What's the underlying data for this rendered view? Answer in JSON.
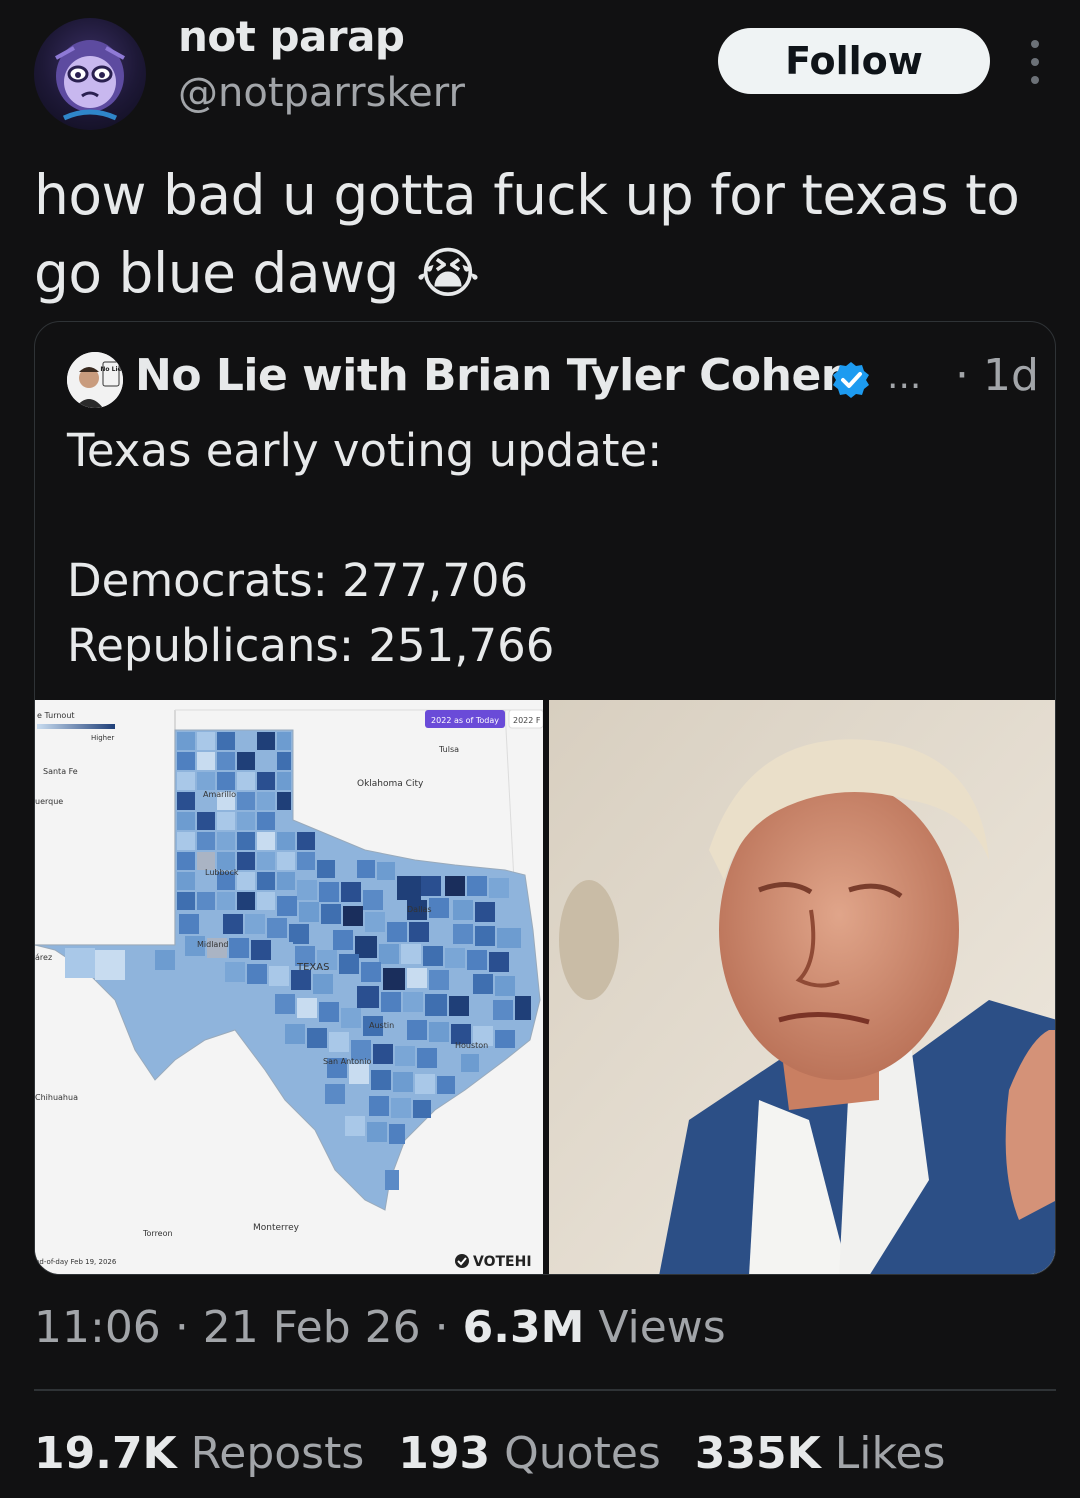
{
  "tweet": {
    "author": {
      "display_name": "not parap",
      "handle": "@notparrskerr"
    },
    "follow_label": "Follow",
    "text": "how bad u gotta fuck up for texas to go blue dawg",
    "emoji": "😭",
    "timestamp": "11:06",
    "date": "21 Feb 26",
    "views_count": "6.3M",
    "views_label": "Views",
    "stats": {
      "reposts_count": "19.7K",
      "reposts_label": "Reposts",
      "quotes_count": "193",
      "quotes_label": "Quotes",
      "likes_count": "335K",
      "likes_label": "Likes"
    }
  },
  "quote": {
    "author_name": "No Lie with Brian Tyler Cohen",
    "avatar_text": "No Lie",
    "ellipsis": "...",
    "time": "· 1d",
    "text": "Texas early voting update:\n\nDemocrats: 277,706\nRepublicans: 251,766",
    "map": {
      "legend_title": "e Turnout",
      "legend_sub": "Higher",
      "tab_active": "2022 as of Today",
      "tab_other": "2022 F",
      "state_label": "TEXAS",
      "cities": [
        "Tulsa",
        "Oklahoma City",
        "Santa Fe",
        "uerque",
        "Amarillo",
        "Lubbock",
        "Dallas",
        "Midland",
        "árez",
        "Austin",
        "Houston",
        "San Antonio",
        "Chihuahua",
        "Torreon",
        "Monterrey"
      ],
      "footer_note": "nd-of-day Feb 19, 2026",
      "watermark": "VOTEHI"
    }
  },
  "colors": {
    "background": "#111112",
    "follow_bg": "#eff3f4",
    "verified": "#1d9bf0",
    "muted_text": "#a2a5a9"
  }
}
